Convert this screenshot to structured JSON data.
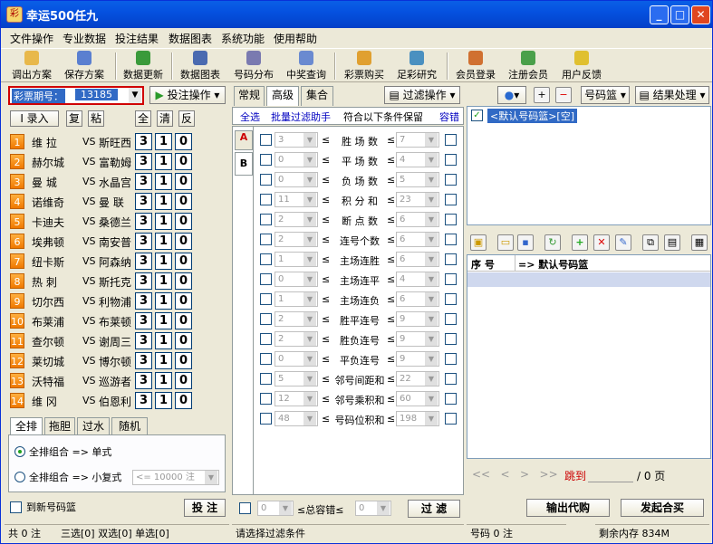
{
  "app": {
    "title": "幸运500任九"
  },
  "menu": [
    "文件操作",
    "专业数据",
    "投注结果",
    "数据图表",
    "系统功能",
    "使用帮助"
  ],
  "toolbar": [
    {
      "label": "调出方案",
      "icon": "folder-open-icon",
      "color": "#e8b84a"
    },
    {
      "label": "保存方案",
      "icon": "save-icon",
      "color": "#5a7fd0"
    },
    {
      "label": "数据更新",
      "icon": "refresh-icon",
      "color": "#3a9a3a"
    },
    {
      "label": "数据图表",
      "icon": "chart-icon",
      "color": "#4a6ab0"
    },
    {
      "label": "号码分布",
      "icon": "grid-icon",
      "color": "#7a7ab0"
    },
    {
      "label": "中奖查询",
      "icon": "search-icon",
      "color": "#6a8ad0"
    },
    {
      "label": "彩票购买",
      "icon": "ticket-icon",
      "color": "#e0a030"
    },
    {
      "label": "足彩研究",
      "icon": "people-icon",
      "color": "#4a90c0"
    },
    {
      "label": "会员登录",
      "icon": "user-icon",
      "color": "#d07030"
    },
    {
      "label": "注册会员",
      "icon": "add-user-icon",
      "color": "#4aa04a"
    },
    {
      "label": "用户反馈",
      "icon": "help-icon",
      "color": "#e0c030"
    }
  ],
  "left": {
    "issue_label": "彩票期号：",
    "issue_value": "13185",
    "bet_action": "投注操作",
    "buttons": {
      "entry": "I 录入",
      "copy": "复",
      "paste": "粘",
      "all": "全",
      "clear": "清",
      "invert": "反"
    },
    "matches": [
      {
        "n": "1",
        "home": "维  拉",
        "away": "斯旺西"
      },
      {
        "n": "2",
        "home": "赫尔城",
        "away": "富勒姆"
      },
      {
        "n": "3",
        "home": "曼  城",
        "away": "水晶宫"
      },
      {
        "n": "4",
        "home": "诺维奇",
        "away": "曼  联"
      },
      {
        "n": "5",
        "home": "卡迪夫",
        "away": "桑德兰"
      },
      {
        "n": "6",
        "home": "埃弗顿",
        "away": "南安普"
      },
      {
        "n": "7",
        "home": "纽卡斯",
        "away": "阿森纳"
      },
      {
        "n": "8",
        "home": "热  刺",
        "away": "斯托克"
      },
      {
        "n": "9",
        "home": "切尔西",
        "away": "利物浦"
      },
      {
        "n": "10",
        "home": "布莱浦",
        "away": "布莱顿"
      },
      {
        "n": "11",
        "home": "查尔顿",
        "away": "谢周三"
      },
      {
        "n": "12",
        "home": "莱切城",
        "away": "博尔顿"
      },
      {
        "n": "13",
        "home": "沃特福",
        "away": "巡游者"
      },
      {
        "n": "14",
        "home": "维  冈",
        "away": "伯恩利"
      }
    ],
    "vs": "VS",
    "odds": [
      "3",
      "1",
      "0"
    ],
    "tabs": [
      "全排",
      "拖胆",
      "过水",
      "随机"
    ],
    "radio1": "全排组合 => 单式",
    "radio2": "全排组合 => 小复式",
    "small_combo": "<= 10000 注",
    "new_basket": "到新号码篮",
    "bet_button": "投 注"
  },
  "middle": {
    "tabs": [
      "常规",
      "高级",
      "集合"
    ],
    "filter_action": "过滤操作",
    "select_all": "全选",
    "batch_helper": "批量过滤助手",
    "keep_label": "符合以下条件保留",
    "tolerance": "容错",
    "side_tabs": [
      "A",
      "B"
    ],
    "filters": [
      {
        "lo": "3",
        "name": "胜 场 数",
        "hi": "7"
      },
      {
        "lo": "0",
        "name": "平 场 数",
        "hi": "4"
      },
      {
        "lo": "0",
        "name": "负 场 数",
        "hi": "5"
      },
      {
        "lo": "11",
        "name": "积 分 和",
        "hi": "23"
      },
      {
        "lo": "2",
        "name": "断 点 数",
        "hi": "6"
      },
      {
        "lo": "2",
        "name": "连号个数",
        "hi": "6"
      },
      {
        "lo": "1",
        "name": "主场连胜",
        "hi": "6"
      },
      {
        "lo": "0",
        "name": "主场连平",
        "hi": "4"
      },
      {
        "lo": "1",
        "name": "主场连负",
        "hi": "6"
      },
      {
        "lo": "2",
        "name": "胜平连号",
        "hi": "9"
      },
      {
        "lo": "2",
        "name": "胜负连号",
        "hi": "9"
      },
      {
        "lo": "0",
        "name": "平负连号",
        "hi": "9"
      },
      {
        "lo": "5",
        "name": "邻号间距和",
        "hi": "22"
      },
      {
        "lo": "12",
        "name": "邻号乘积和",
        "hi": "60"
      },
      {
        "lo": "48",
        "name": "号码位积和",
        "hi": "198"
      }
    ],
    "le": "≤",
    "total_lo": "0",
    "total_label": "≤总容错≤",
    "total_hi": "0",
    "filter_button": "过 滤"
  },
  "right": {
    "num_basket": "号码篮",
    "result_proc": "结果处理",
    "basket_item": "<默认号码篮>[空]",
    "col_seq": "序  号",
    "col_basket": "=> 默认号码篮",
    "pager_jump": "跳到",
    "pager_pages": "/ 0 页",
    "export_code": "输出代购",
    "send_buy": "发起合买"
  },
  "status": {
    "total": "共 0 注",
    "picks": "三选[0] 双选[0] 单选[0]",
    "hint": "请选择过滤条件",
    "code": "号码 0 注",
    "mem": "剩余内存  834M"
  }
}
